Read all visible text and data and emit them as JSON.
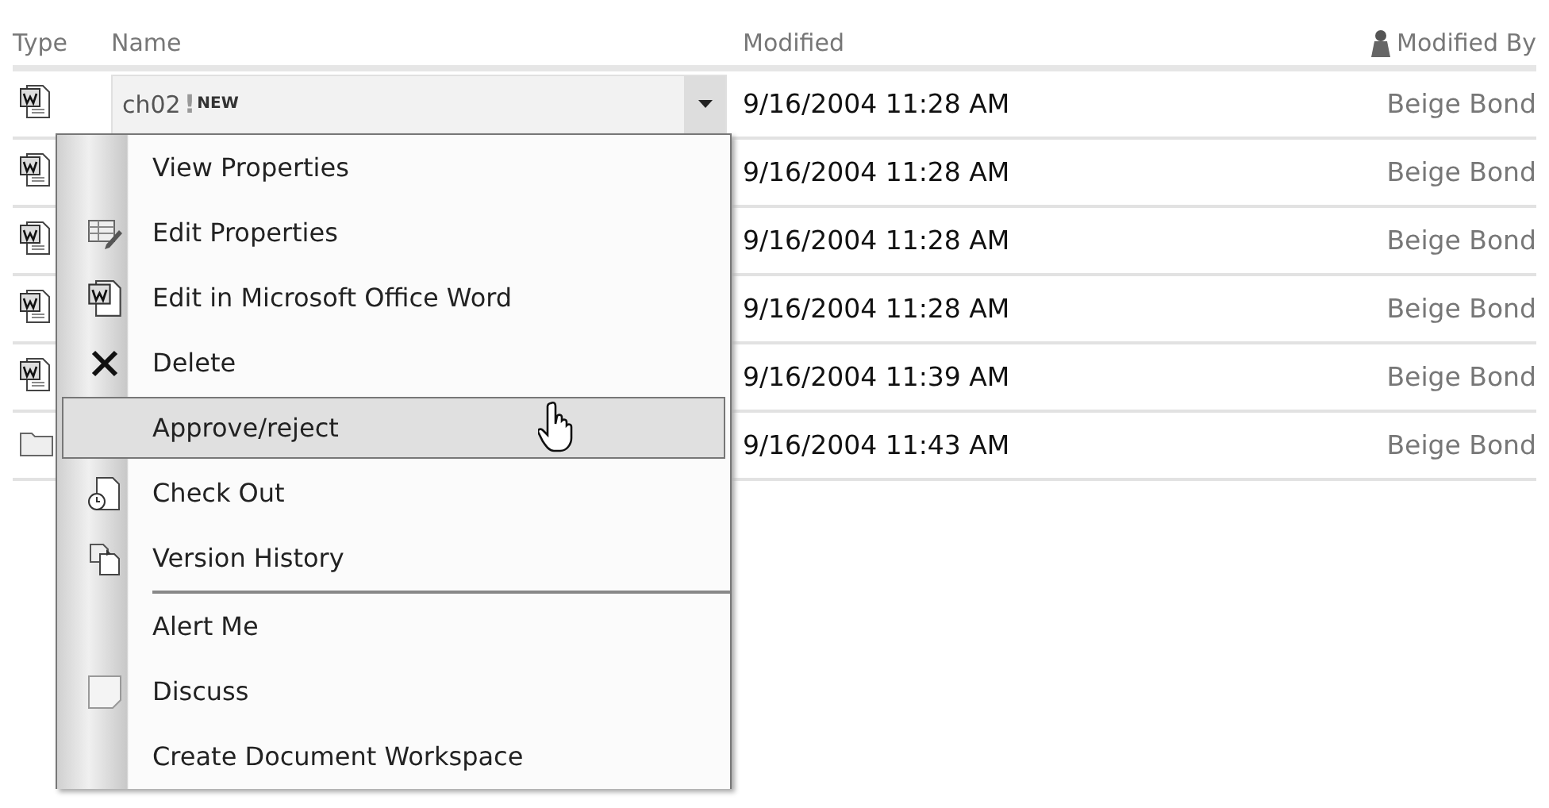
{
  "table": {
    "columns": [
      {
        "label": "Type"
      },
      {
        "label": "Name"
      },
      {
        "label": "Modified"
      },
      {
        "label": "Modified By"
      }
    ],
    "rows": [
      {
        "kind": "document",
        "name": "ch02",
        "badge_mark": "!",
        "badge": "NEW",
        "modified": "9/16/2004 11:28 AM",
        "modified_by": "Beige Bond"
      },
      {
        "kind": "document",
        "modified": "9/16/2004 11:28 AM",
        "modified_by": "Beige Bond"
      },
      {
        "kind": "document",
        "modified": "9/16/2004 11:28 AM",
        "modified_by": "Beige Bond"
      },
      {
        "kind": "document",
        "modified": "9/16/2004 11:28 AM",
        "modified_by": "Beige Bond"
      },
      {
        "kind": "document",
        "modified": "9/16/2004 11:39 AM",
        "modified_by": "Beige Bond"
      },
      {
        "kind": "folder",
        "modified": "9/16/2004 11:43 AM",
        "modified_by": "Beige Bond"
      }
    ]
  },
  "context_menu": {
    "items": [
      {
        "label": "View Properties",
        "kind": "plain",
        "selected": false,
        "divider_above": false
      },
      {
        "label": "Edit Properties",
        "kind": "edit",
        "selected": false,
        "divider_above": false
      },
      {
        "label": "Edit in Microsoft Office Word",
        "kind": "word",
        "selected": false,
        "divider_above": false
      },
      {
        "label": "Delete",
        "kind": "delete",
        "selected": false,
        "divider_above": false
      },
      {
        "label": "Approve/reject",
        "kind": "plain",
        "selected": true,
        "divider_above": false
      },
      {
        "label": "Check Out",
        "kind": "checkout",
        "selected": false,
        "divider_above": false
      },
      {
        "label": "Version History",
        "kind": "history",
        "selected": false,
        "divider_above": false
      },
      {
        "label": "Alert Me",
        "kind": "plain",
        "selected": false,
        "divider_above": true
      },
      {
        "label": "Discuss",
        "kind": "discuss",
        "selected": false,
        "divider_above": false
      },
      {
        "label": "Create Document Workspace",
        "kind": "plain",
        "selected": false,
        "divider_above": false
      }
    ]
  }
}
